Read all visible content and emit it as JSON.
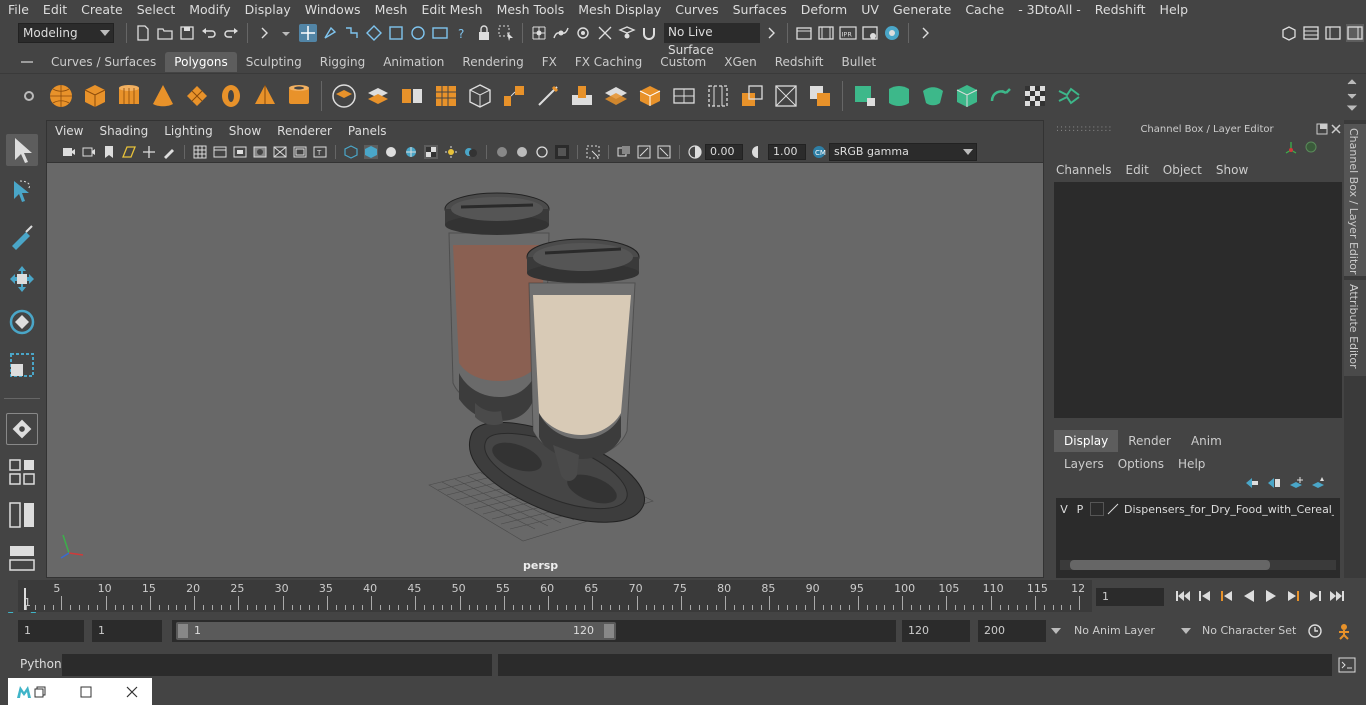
{
  "menubar": {
    "items": [
      "File",
      "Edit",
      "Create",
      "Select",
      "Modify",
      "Display",
      "Windows",
      "Mesh",
      "Edit Mesh",
      "Mesh Tools",
      "Mesh Display",
      "Curves",
      "Surfaces",
      "Deform",
      "UV",
      "Generate",
      "Cache",
      "- 3DtoAll -",
      "Redshift",
      "Help"
    ]
  },
  "statusline": {
    "mode": "Modeling",
    "live_surface": "No Live Surface"
  },
  "shelf": {
    "tabs": [
      "Curves / Surfaces",
      "Polygons",
      "Sculpting",
      "Rigging",
      "Animation",
      "Rendering",
      "FX",
      "FX Caching",
      "Custom",
      "XGen",
      "Redshift",
      "Bullet"
    ],
    "active_tab": "Polygons"
  },
  "viewport": {
    "menu": [
      "View",
      "Shading",
      "Lighting",
      "Show",
      "Renderer",
      "Panels"
    ],
    "exposure": "0.00",
    "gamma": "1.00",
    "color_space": "sRGB gamma",
    "camera_label": "persp"
  },
  "channel_box": {
    "title": "Channel Box / Layer Editor",
    "menu": [
      "Channels",
      "Edit",
      "Object",
      "Show"
    ],
    "layer_tabs": [
      "Display",
      "Render",
      "Anim"
    ],
    "active_layer_tab": "Display",
    "layer_menu": [
      "Layers",
      "Options",
      "Help"
    ],
    "layer_row": {
      "v": "V",
      "p": "P",
      "name": "Dispensers_for_Dry_Food_with_Cereal_Bla"
    }
  },
  "side_tabs": [
    "Channel Box / Layer Editor",
    "Attribute Editor"
  ],
  "timeline": {
    "labels": [
      "5",
      "10",
      "15",
      "20",
      "25",
      "30",
      "35",
      "40",
      "45",
      "50",
      "55",
      "60",
      "65",
      "70",
      "75",
      "80",
      "85",
      "90",
      "95",
      "100",
      "105",
      "110",
      "115",
      "12"
    ],
    "start_marker": "1",
    "current_frame": "1"
  },
  "range": {
    "start": "1",
    "playback_start": "1",
    "slider_start": "1",
    "slider_end": "120",
    "playback_end": "120",
    "end": "200",
    "anim_layer": "No Anim Layer",
    "character_set": "No Character Set"
  },
  "cmdline": {
    "label": "Python"
  },
  "colors": {
    "accent": "#5d5d5d",
    "selected_tool": "#5285a6",
    "shelf_orange": "#e8922a",
    "shelf_green": "#3db88a"
  }
}
